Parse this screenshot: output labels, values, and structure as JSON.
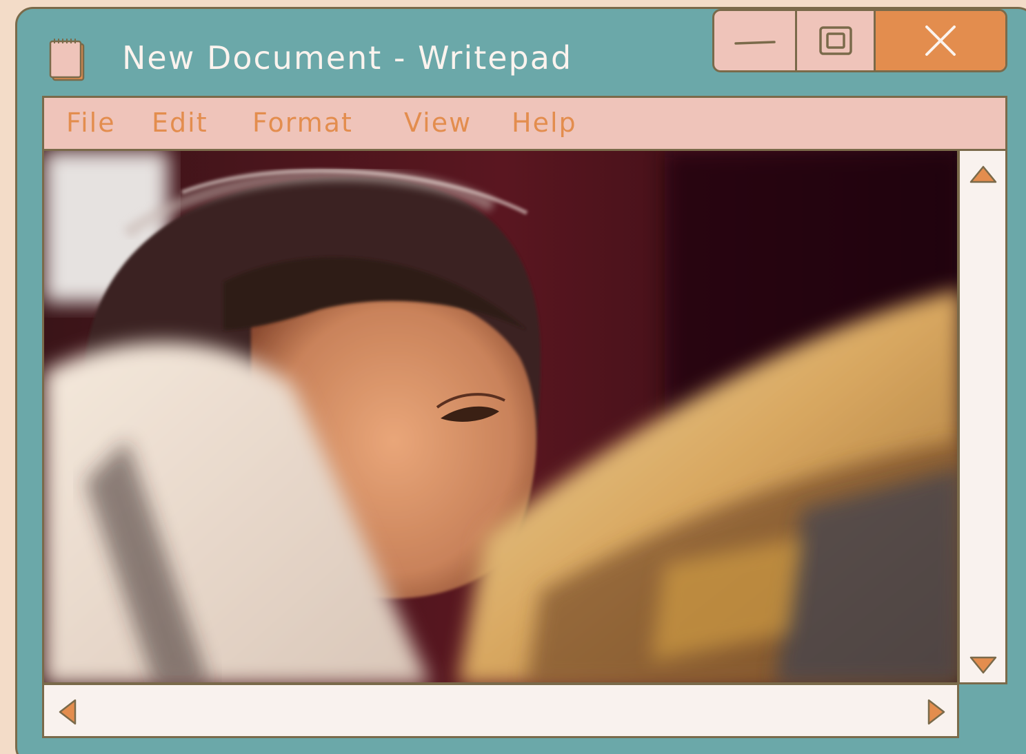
{
  "window": {
    "title": "New Document - Writepad",
    "icon": "notepad-icon"
  },
  "controls": {
    "minimize_icon": "minimize-icon",
    "maximize_icon": "maximize-icon",
    "close_icon": "close-icon"
  },
  "menu": {
    "items": [
      "File",
      "Edit",
      "Format",
      "View",
      "Help"
    ]
  },
  "content": {
    "image": "photo-child-reading-book"
  },
  "scrollbars": {
    "up_icon": "arrow-up-icon",
    "down_icon": "arrow-down-icon",
    "left_icon": "arrow-left-icon",
    "right_icon": "arrow-right-icon"
  },
  "colors": {
    "window_teal": "#6ba8a9",
    "menubar_pink": "#efc4ba",
    "accent_orange": "#e38d4e",
    "outline_brown": "#7a6a4a",
    "scroll_bg": "#f9f2ee",
    "page_bg": "#f3dcc8"
  }
}
